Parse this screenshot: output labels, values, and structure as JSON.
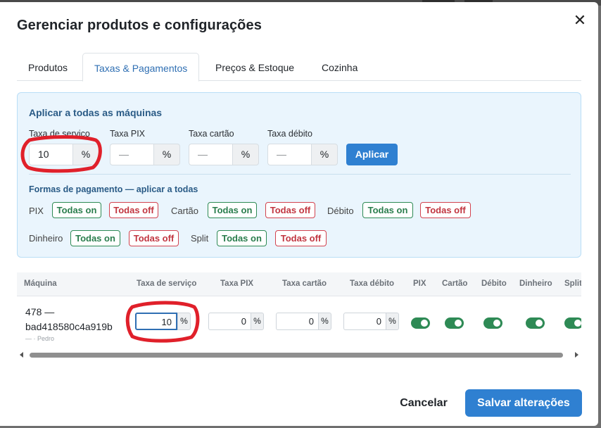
{
  "dialog": {
    "title": "Gerenciar produtos e configurações",
    "close_glyph": "✕"
  },
  "tabs": [
    {
      "label": "Produtos",
      "active": false
    },
    {
      "label": "Taxas & Pagamentos",
      "active": true
    },
    {
      "label": "Preços & Estoque",
      "active": false
    },
    {
      "label": "Cozinha",
      "active": false
    }
  ],
  "apply_all": {
    "title": "Aplicar a todas as máquinas",
    "fields": [
      {
        "label": "Taxa de serviço",
        "value": "10",
        "suffix": "%"
      },
      {
        "label": "Taxa PIX",
        "value": "—",
        "suffix": "%"
      },
      {
        "label": "Taxa cartão",
        "value": "—",
        "suffix": "%"
      },
      {
        "label": "Taxa débito",
        "value": "—",
        "suffix": "%"
      }
    ],
    "apply_label": "Aplicar",
    "payments_title": "Formas de pagamento — aplicar a todas",
    "payments": [
      {
        "label": "PIX",
        "on": "Todas on",
        "off": "Todas off"
      },
      {
        "label": "Cartão",
        "on": "Todas on",
        "off": "Todas off"
      },
      {
        "label": "Débito",
        "on": "Todas on",
        "off": "Todas off"
      },
      {
        "label": "Dinheiro",
        "on": "Todas on",
        "off": "Todas off"
      },
      {
        "label": "Split",
        "on": "Todas on",
        "off": "Todas off"
      }
    ]
  },
  "table": {
    "columns": [
      "Máquina",
      "Taxa de serviço",
      "Taxa PIX",
      "Taxa cartão",
      "Taxa débito",
      "PIX",
      "Cartão",
      "Débito",
      "Dinheiro",
      "Split"
    ],
    "rows": [
      {
        "name_line1": "478 —",
        "name_line2": "bad418580c4a919b",
        "sub": "— · Pedro",
        "taxa_servico": "10",
        "taxa_pix": "0",
        "taxa_cartao": "0",
        "taxa_debito": "0",
        "suffix": "%",
        "pix_on": true,
        "cartao_on": true,
        "debito_on": true,
        "dinheiro_on": true,
        "split_on": true
      }
    ]
  },
  "footer": {
    "cancel_label": "Cancelar",
    "save_label": "Salvar alterações"
  },
  "colors": {
    "primary": "#2f80d1",
    "active_tab_text": "#2f6fb3",
    "panel_bg": "#eaf5fd",
    "toggle_on": "#2e8a55",
    "pill_on": "#2e8a55",
    "pill_off": "#d2434f",
    "annotation": "#e0202a"
  }
}
